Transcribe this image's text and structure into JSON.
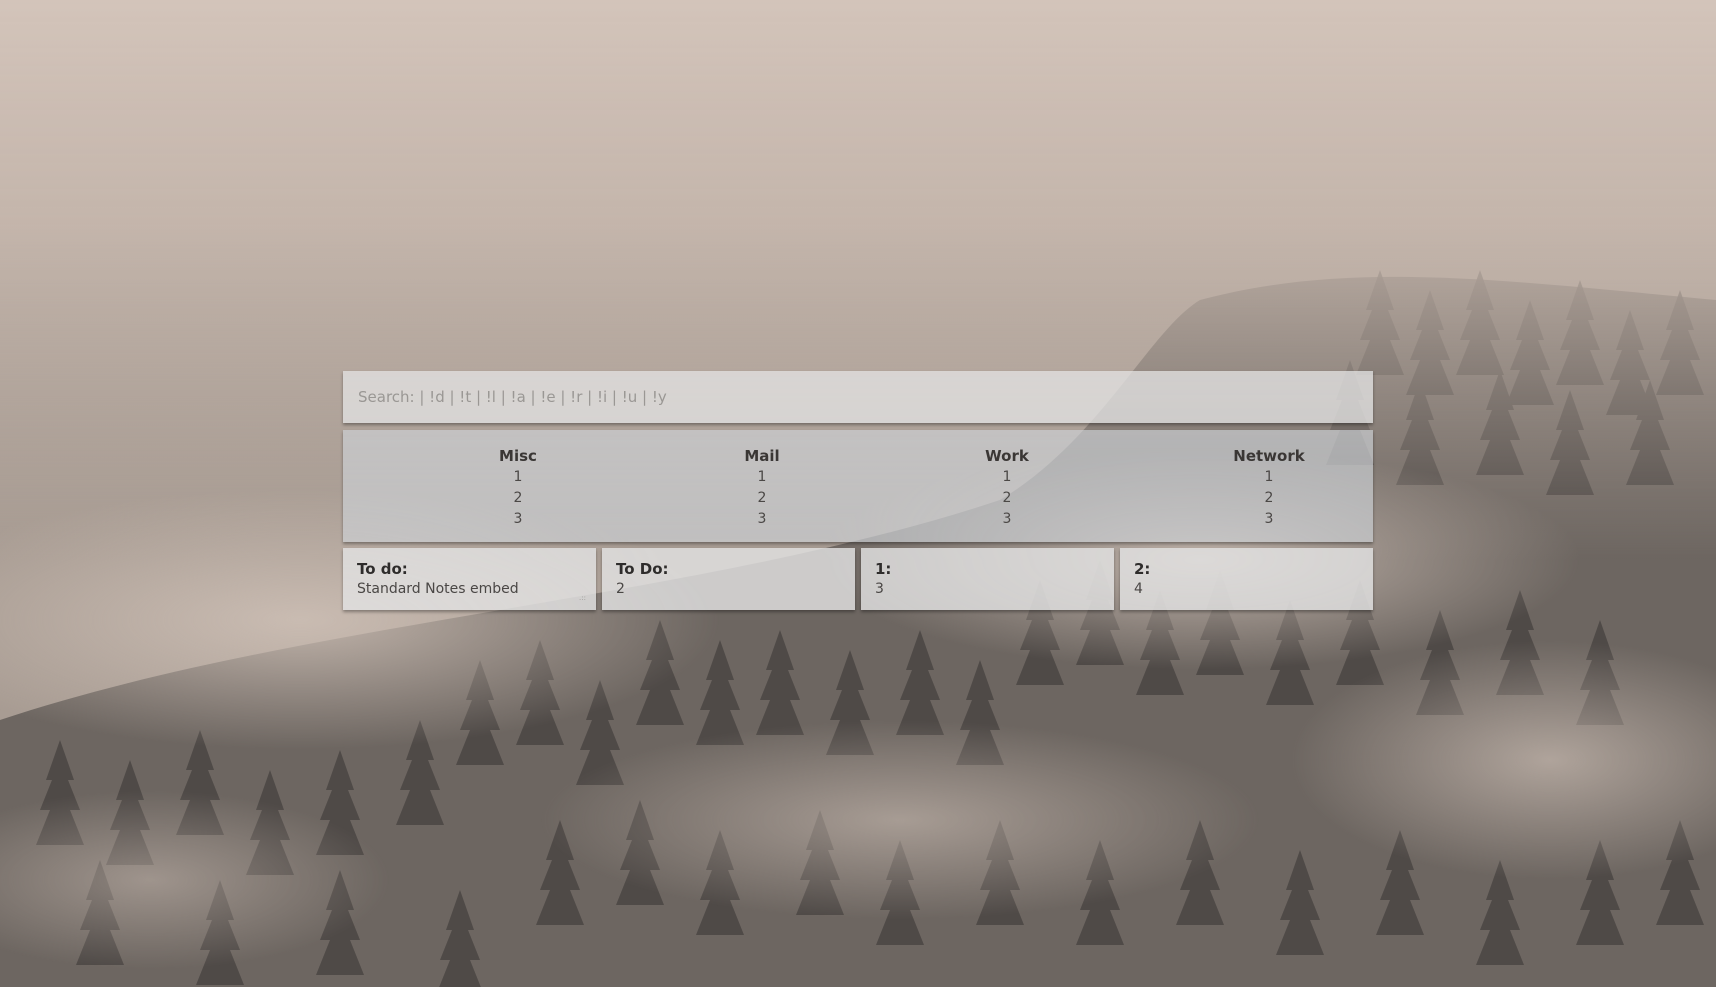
{
  "search": {
    "placeholder": "Search: | !d | !t | !l | !a | !e | !r | !i | !u | !y"
  },
  "categories": [
    {
      "name": "Misc",
      "links": [
        "1",
        "2",
        "3"
      ]
    },
    {
      "name": "Mail",
      "links": [
        "1",
        "2",
        "3"
      ]
    },
    {
      "name": "Work",
      "links": [
        "1",
        "2",
        "3"
      ]
    },
    {
      "name": "Network",
      "links": [
        "1",
        "2",
        "3"
      ]
    }
  ],
  "notes": [
    {
      "title": "To do:",
      "body": "Standard Notes embed"
    },
    {
      "title": "To Do:",
      "body": "2"
    },
    {
      "title": "1:",
      "body": "3"
    },
    {
      "title": "2:",
      "body": "4"
    }
  ],
  "colors": {
    "panel": "#e2e2e2",
    "text_dark": "#2e2c2b",
    "placeholder": "#9a9794"
  }
}
